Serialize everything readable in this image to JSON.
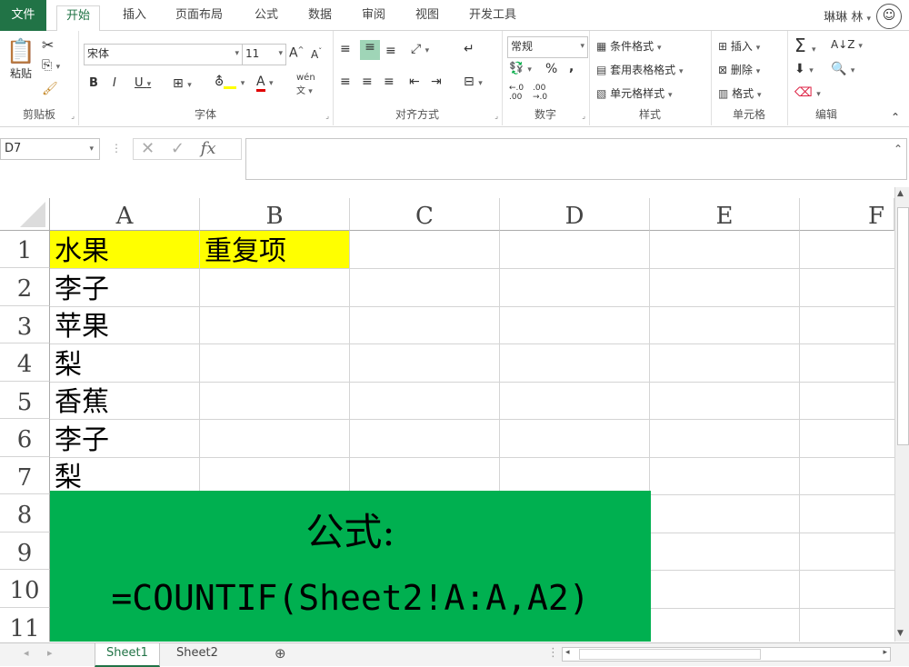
{
  "ribbon_tabs": [
    "文件",
    "开始",
    "插入",
    "页面布局",
    "公式",
    "数据",
    "审阅",
    "视图",
    "开发工具"
  ],
  "user": "琳琳 林",
  "clipboard": {
    "paste": "粘贴",
    "group": "剪贴板"
  },
  "font": {
    "name": "宋体",
    "size": "11",
    "group": "字体",
    "bold": "B",
    "italic": "I",
    "underline": "U",
    "pinyin": "wén"
  },
  "alignment": {
    "group": "对齐方式"
  },
  "number": {
    "format": "常规",
    "group": "数字",
    "percent": "%",
    "comma": ","
  },
  "styles": {
    "conditional": "条件格式",
    "table": "套用表格格式",
    "cell": "单元格样式",
    "group": "样式"
  },
  "cells": {
    "insert": "插入",
    "delete": "删除",
    "format": "格式",
    "group": "单元格"
  },
  "editing": {
    "group": "编辑",
    "sum": "Σ"
  },
  "formula_bar": {
    "name_box": "D7",
    "fx": "fx",
    "value": ""
  },
  "columns": [
    "A",
    "B",
    "C",
    "D",
    "E",
    "F"
  ],
  "rows": [
    "1",
    "2",
    "3",
    "4",
    "5",
    "6",
    "7",
    "8",
    "9",
    "10",
    "11"
  ],
  "cells_data": {
    "A1": "水果",
    "B1": "重复项",
    "A2": "李子",
    "A3": "苹果",
    "A4": "梨",
    "A5": "香蕉",
    "A6": "李子",
    "A7": "梨"
  },
  "note": {
    "line1": "公式:",
    "line2": "=COUNTIF(Sheet2!A:A,A2)"
  },
  "sheets": [
    "Sheet1",
    "Sheet2"
  ],
  "colors": {
    "excel_green": "#217346",
    "header_yellow": "#ffff00",
    "note_green": "#00b050"
  }
}
